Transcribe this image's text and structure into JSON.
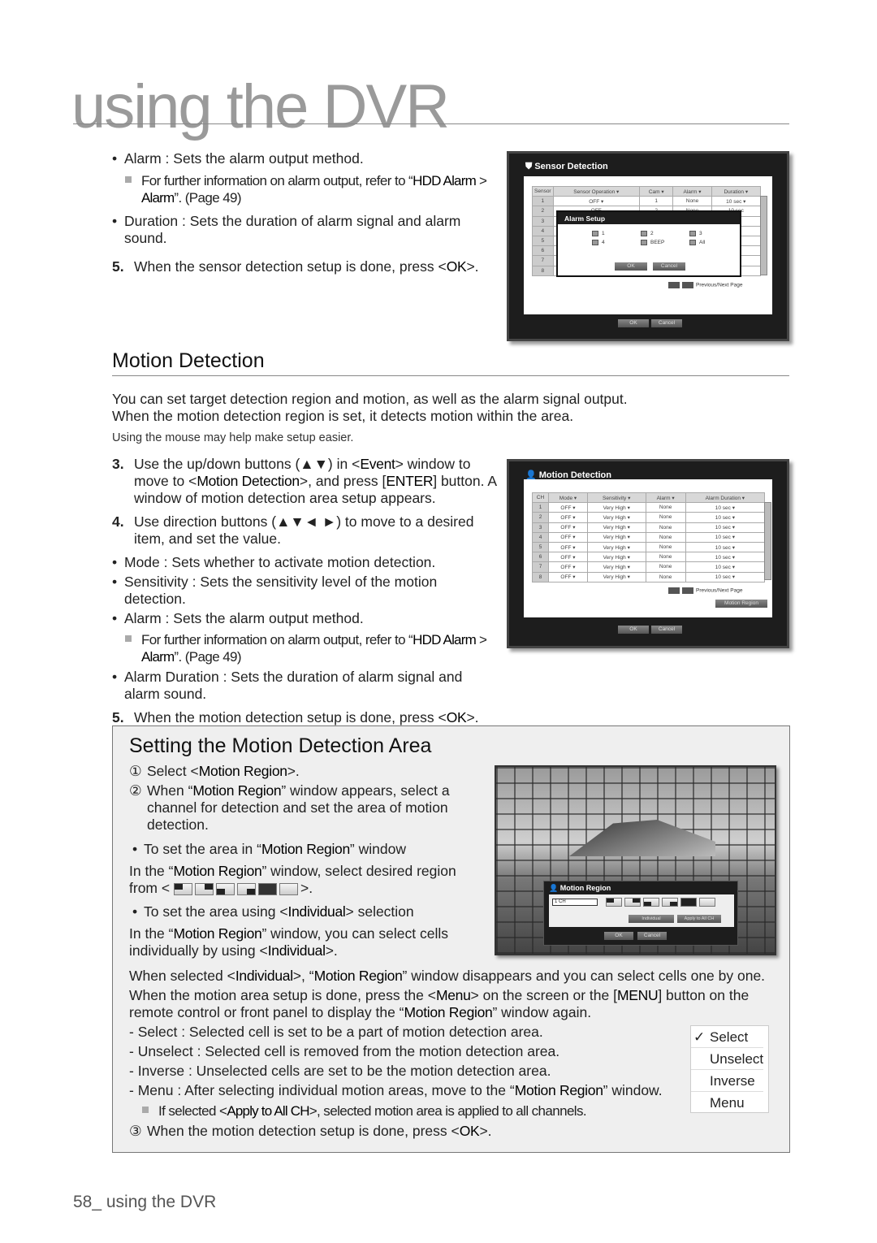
{
  "header": {
    "title": "using the DVR"
  },
  "sensor_text": {
    "bullet_alarm": [
      {
        "t": "Alarm : Sets the alarm output method."
      }
    ],
    "note": [
      {
        "t": "For further information on alarm output, refer to “"
      },
      {
        "t": "HDD Alarm",
        "b": true
      },
      {
        "t": " > "
      },
      {
        "t": "Alarm",
        "b": true
      },
      {
        "t": "”. (Page 49)"
      }
    ],
    "bullet_duration": [
      {
        "t": "Duration : Sets the duration of alarm signal and alarm sound."
      }
    ],
    "step5_num": "5.",
    "step5": [
      {
        "t": "When the sensor detection setup is done, press <"
      },
      {
        "t": "OK",
        "b": true
      },
      {
        "t": ">."
      }
    ]
  },
  "sensor_screen": {
    "title": "Sensor Detection",
    "columns": [
      "Sensor",
      "Sensor Operation ▾",
      "Cam ▾",
      "Alarm ▾",
      "Duration ▾"
    ],
    "rows": [
      [
        "1",
        "OFF ▾",
        "1",
        "None",
        "10 sec ▾"
      ],
      [
        "2",
        "OFF",
        "2",
        "None",
        "10 sec"
      ],
      [
        "3",
        "",
        "",
        "",
        ""
      ],
      [
        "4",
        "",
        "",
        "",
        ""
      ],
      [
        "5",
        "",
        "",
        "",
        ""
      ],
      [
        "6",
        "",
        "",
        "",
        ""
      ],
      [
        "7",
        "",
        "",
        "",
        ""
      ],
      [
        "8",
        "",
        "",
        "",
        ""
      ]
    ],
    "pager_label": "Previous/Next Page",
    "ok": "OK",
    "cancel": "Cancel",
    "popup": {
      "title": "Alarm Setup",
      "options": [
        "1",
        "2",
        "3",
        "4",
        "BEEP",
        "All"
      ],
      "ok": "OK",
      "cancel": "Cancel"
    }
  },
  "motion": {
    "heading": "Motion Detection",
    "intro1": "You can set target detection region and motion, as well as the alarm signal output.",
    "intro2": "When the motion detection region is set, it detects motion within the area.",
    "hint": "Using the mouse may help make setup easier.",
    "step3_num": "3.",
    "step3": [
      {
        "t": "Use the up/down buttons (▲▼) in <"
      },
      {
        "t": "Event",
        "b": true
      },
      {
        "t": "> window to move to <"
      },
      {
        "t": "Motion Detection",
        "b": true
      },
      {
        "t": ">, and press ["
      },
      {
        "t": "ENTER",
        "b": true
      },
      {
        "t": "] button. A window of motion detection area setup appears."
      }
    ],
    "step4_num": "4.",
    "step4": [
      {
        "t": "Use direction buttons (▲▼◄ ►) to move to a desired item, and set the value."
      }
    ],
    "bullet_mode": [
      {
        "t": "Mode : Sets whether to activate motion detection."
      }
    ],
    "bullet_sens": [
      {
        "t": "Sensitivity : Sets the sensitivity level of the motion detection."
      }
    ],
    "bullet_alarm": [
      {
        "t": "Alarm : Sets the alarm output method."
      }
    ],
    "note": [
      {
        "t": "For further information on alarm output, refer to “"
      },
      {
        "t": "HDD Alarm",
        "b": true
      },
      {
        "t": " > "
      },
      {
        "t": "Alarm",
        "b": true
      },
      {
        "t": "”. (Page 49)"
      }
    ],
    "bullet_dur": [
      {
        "t": "Alarm Duration : Sets the duration of alarm signal and alarm sound."
      }
    ],
    "step5_num": "5.",
    "step5": [
      {
        "t": "When the motion detection setup is done, press <"
      },
      {
        "t": "OK",
        "b": true
      },
      {
        "t": ">."
      }
    ]
  },
  "motion_screen": {
    "title": "Motion Detection",
    "columns": [
      "CH",
      "Mode ▾",
      "Sensitivity ▾",
      "Alarm ▾",
      "Alarm Duration ▾"
    ],
    "rows": [
      [
        "1",
        "OFF ▾",
        "Very High ▾",
        "None",
        "10 sec ▾"
      ],
      [
        "2",
        "OFF ▾",
        "Very High ▾",
        "None",
        "10 sec ▾"
      ],
      [
        "3",
        "OFF ▾",
        "Very High ▾",
        "None",
        "10 sec ▾"
      ],
      [
        "4",
        "OFF ▾",
        "Very High ▾",
        "None",
        "10 sec ▾"
      ],
      [
        "5",
        "OFF ▾",
        "Very High ▾",
        "None",
        "10 sec ▾"
      ],
      [
        "6",
        "OFF ▾",
        "Very High ▾",
        "None",
        "10 sec ▾"
      ],
      [
        "7",
        "OFF ▾",
        "Very High ▾",
        "None",
        "10 sec ▾"
      ],
      [
        "8",
        "OFF ▾",
        "Very High ▾",
        "None",
        "10 sec ▾"
      ]
    ],
    "pager_label": "Previous/Next Page",
    "motion_region_btn": "Motion Region",
    "ok": "OK",
    "cancel": "Cancel"
  },
  "area_box": {
    "title": "Setting the Motion Detection Area",
    "s1_num": "①",
    "s1": [
      {
        "t": "Select <"
      },
      {
        "t": "Motion Region",
        "b": true
      },
      {
        "t": ">."
      }
    ],
    "s2_num": "②",
    "s2": [
      {
        "t": "When “"
      },
      {
        "t": "Motion Region",
        "b": true
      },
      {
        "t": "” window appears, select a channel for detection and set the area of motion detection."
      }
    ],
    "b1": [
      {
        "t": "To set the area in “"
      },
      {
        "t": "Motion Region",
        "b": true
      },
      {
        "t": "” window"
      }
    ],
    "p1": [
      {
        "t": "In the “"
      },
      {
        "t": "Motion Region",
        "b": true
      },
      {
        "t": "” window, select desired region"
      }
    ],
    "from_pre": "from <",
    "from_post": ">.",
    "b2": [
      {
        "t": "To set the area using <"
      },
      {
        "t": "Individual",
        "b": true
      },
      {
        "t": "> selection"
      }
    ],
    "p2": [
      {
        "t": "In the “"
      },
      {
        "t": "Motion Region",
        "b": true
      },
      {
        "t": "” window, you can select cells individually by using <"
      },
      {
        "t": "Individual",
        "b": true
      },
      {
        "t": ">."
      }
    ],
    "p3": [
      {
        "t": "When selected <"
      },
      {
        "t": "Individual",
        "b": true
      },
      {
        "t": ">, “"
      },
      {
        "t": "Motion Region",
        "b": true
      },
      {
        "t": "” window disappears and you can select cells one by one."
      }
    ],
    "p4": [
      {
        "t": "When the motion area setup is done, press the <"
      },
      {
        "t": "Menu",
        "b": true
      },
      {
        "t": "> on the screen or the ["
      },
      {
        "t": "MENU",
        "b": true
      },
      {
        "t": "] button on the remote control or front panel to display the “"
      },
      {
        "t": "Motion Region",
        "b": true
      },
      {
        "t": "” window again."
      }
    ],
    "d1": [
      {
        "t": "- Select : Selected cell is set to be a part of motion detection area."
      }
    ],
    "d2": [
      {
        "t": "- Unselect : Selected cell is removed from the motion detection area."
      }
    ],
    "d3": [
      {
        "t": "- Inverse : Unselected cells are set to be the motion detection area."
      }
    ],
    "d4": [
      {
        "t": "- Menu : After selecting individual motion areas, move to the “"
      },
      {
        "t": "Motion Region",
        "b": true
      },
      {
        "t": "” window."
      }
    ],
    "note": [
      {
        "t": "If selected <"
      },
      {
        "t": "Apply to All CH",
        "b": true
      },
      {
        "t": ">, selected motion area is applied to all channels."
      }
    ],
    "s3_num": "③",
    "s3": [
      {
        "t": "When the motion detection setup is done, press <"
      },
      {
        "t": "OK",
        "b": true
      },
      {
        "t": ">."
      }
    ],
    "menu": [
      "Select",
      "Unselect",
      "Inverse",
      "Menu"
    ],
    "menu_checked": "Select"
  },
  "region_screen": {
    "title": "Motion Region",
    "channel": "1 CH",
    "individual": "Individual",
    "apply_all": "Apply to All CH",
    "ok": "OK",
    "cancel": "Cancel"
  },
  "footer": {
    "page": "58_ using the DVR"
  }
}
